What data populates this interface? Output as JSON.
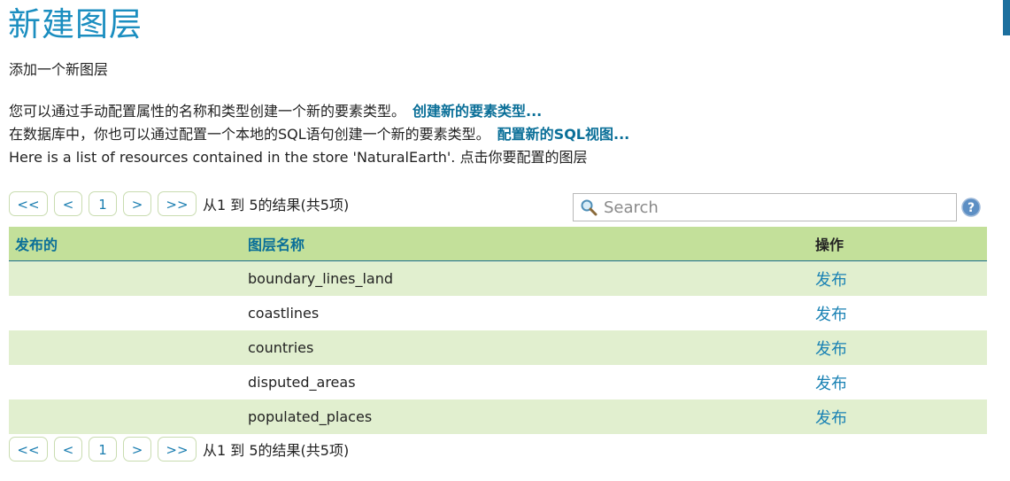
{
  "page": {
    "title": "新建图层",
    "subtitle": "添加一个新图层",
    "desc": {
      "line1_text": "您可以通过手动配置属性的名称和类型创建一个新的要素类型。",
      "line1_link": "创建新的要素类型...",
      "line2_text": "在数据库中，你也可以通过配置一个本地的SQL语句创建一个新的要素类型。",
      "line2_link": "配置新的SQL视图...",
      "line3_text": "Here is a list of resources contained in the store 'NaturalEarth'. 点击你要配置的图层"
    }
  },
  "pager": {
    "first": "<<",
    "prev": "<",
    "page": "1",
    "next": ">",
    "last": ">>",
    "info": "从1 到 5的结果(共5项)"
  },
  "search": {
    "placeholder": "Search",
    "value": ""
  },
  "table": {
    "headers": [
      "发布的",
      "图层名称",
      "操作"
    ],
    "rows": [
      {
        "published": "",
        "name": "boundary_lines_land",
        "action": "发布"
      },
      {
        "published": "",
        "name": "coastlines",
        "action": "发布"
      },
      {
        "published": "",
        "name": "countries",
        "action": "发布"
      },
      {
        "published": "",
        "name": "disputed_areas",
        "action": "发布"
      },
      {
        "published": "",
        "name": "populated_places",
        "action": "发布"
      }
    ]
  },
  "icons": {
    "search": "search-icon",
    "help": "help-icon"
  },
  "colors": {
    "title": "#1b8ec0",
    "link": "#0a6f98",
    "header_bg": "#c3e09a",
    "row_alt_bg": "#e1efcf"
  }
}
